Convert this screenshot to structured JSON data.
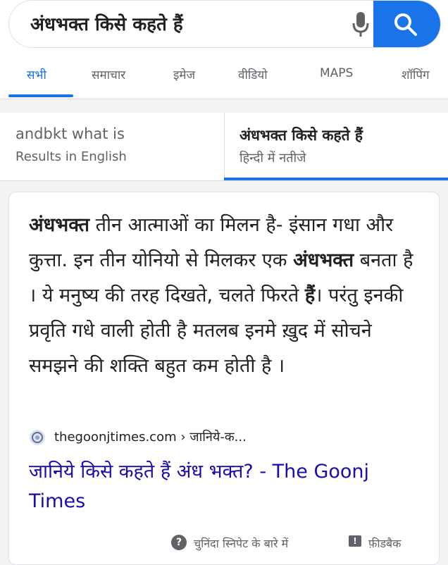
{
  "search": {
    "query": "अंधभक्त किसे कहते हैं"
  },
  "tabs": [
    {
      "label": "सभी",
      "active": true
    },
    {
      "label": "समाचार"
    },
    {
      "label": "इमेज"
    },
    {
      "label": "वीडियो"
    },
    {
      "label": "MAPS"
    },
    {
      "label": "शॉपिंग"
    }
  ],
  "language_toggle": {
    "english": {
      "query": "andbkt what is",
      "subtitle": "Results in English"
    },
    "hindi": {
      "query": "अंधभक्त किसे कहते हैं",
      "subtitle": "हिन्दी में नतीजे"
    }
  },
  "featured_snippet": {
    "segments": [
      {
        "text": "अंधभक्त",
        "bold": true
      },
      {
        "text": " तीन आत्माओं का मिलन है- इंसान गधा और कुत्ता. इन तीन योनियो से मिलकर एक ",
        "bold": false
      },
      {
        "text": "अंधभक्त",
        "bold": true
      },
      {
        "text": " बनता है । ये मनुष्य की तरह दिखते, चलते फिरते ",
        "bold": false
      },
      {
        "text": "हैं",
        "bold": true
      },
      {
        "text": "। परंतु इनकी प्रवृति गधे वाली होती है मतलब इनमे ख़ुद में सोचने समझने की शक्ति बहुत कम होती है ।",
        "bold": false
      }
    ],
    "source_url": "thegoonjtimes.com › जानिये-क...",
    "result_title": "जानिये किसे कहते हैं अंध भक्त? - The Goonj Times",
    "footer": {
      "about_label": "चुनिंदा स्निपेट के बारे में",
      "feedback_label": "फ़ीडबैक"
    }
  },
  "colors": {
    "accent": "#1a73e8",
    "link": "#1a0dab"
  }
}
